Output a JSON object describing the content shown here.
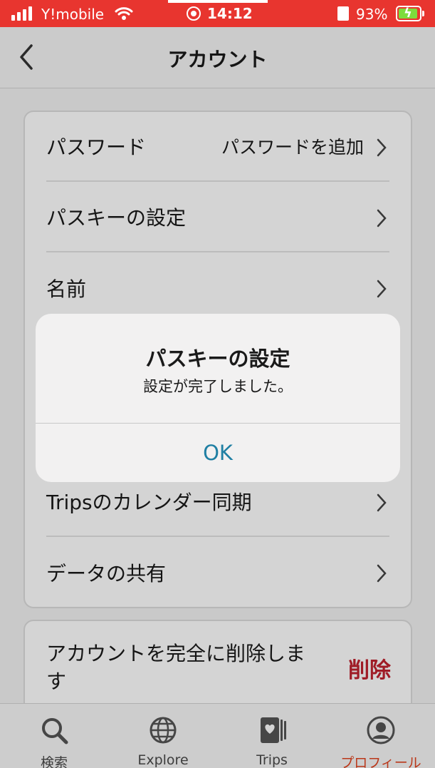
{
  "status_bar": {
    "carrier": "Y!mobile",
    "time": "14:12",
    "battery": "93%",
    "battery_level": 0.93,
    "battery_color": "#7ddc3c",
    "background": "#e8352f"
  },
  "header": {
    "title": "アカウント",
    "back_icon": "chevron-left-icon"
  },
  "settings": {
    "rows": [
      {
        "label": "パスワード",
        "value": "パスワードを追加"
      },
      {
        "label": "パスキーの設定"
      },
      {
        "label": "名前"
      },
      {
        "label": "Tripsのカレンダー同期"
      },
      {
        "label": "データの共有"
      }
    ]
  },
  "delete_section": {
    "text": "アカウントを完全に削除します",
    "button": "削除",
    "button_color": "#c0222e"
  },
  "alert": {
    "title": "パスキーの設定",
    "message": "設定が完了しました。",
    "ok": "OK",
    "ok_color": "#1f7fa3"
  },
  "tabs": [
    {
      "label": "検索",
      "icon": "search-icon"
    },
    {
      "label": "Explore",
      "icon": "globe-icon"
    },
    {
      "label": "Trips",
      "icon": "trips-heart-icon"
    },
    {
      "label": "プロフィール",
      "icon": "profile-icon",
      "active": true,
      "color": "#e0431f"
    }
  ]
}
